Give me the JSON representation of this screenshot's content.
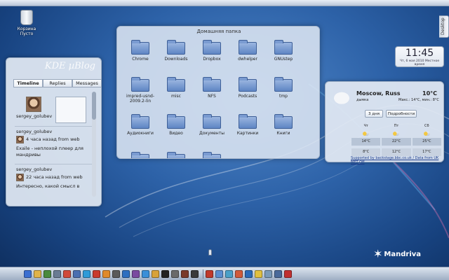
{
  "desktop": {
    "trash_label_line1": "Корзина",
    "trash_label_line2": "Пусто",
    "desktop_tab_label": "Desktop",
    "brand_name": "Mandriva"
  },
  "microblog": {
    "logo": "KDE µBlog",
    "tabs": [
      "Timeline",
      "Replies",
      "Messages"
    ],
    "own_user": "sergey_golubev",
    "posts": [
      {
        "user": "sergey_golubev",
        "meta": "4 часа назад from web",
        "text_line1": "Exaile - неплохой плеер для",
        "text_line2": "мандривы"
      },
      {
        "user": "sergey_golubev",
        "meta": "22 часа назад from web",
        "text_line1": "Интересно, какой смысл в",
        "text_line2": ""
      }
    ]
  },
  "folderview": {
    "title": "Домашняя папка",
    "items": [
      "Chrome",
      "Downloads",
      "Dropbox",
      "dwhelper",
      "GNUstep",
      "impred-usnd-2009.2-lin",
      "misc",
      "NFS",
      "Podcasts",
      "tmp",
      "Аудиокниги",
      "Видео",
      "Документы",
      "Картинки",
      "Книги"
    ]
  },
  "clock": {
    "time": "11:45",
    "date": "Чт, 6 мая 2010 Местное время"
  },
  "weather": {
    "city": "Moscow, Russ",
    "temperature": "10°C",
    "condition": "дымка",
    "range": "Макс.: 14°C, мин.: 8°C",
    "buttons": [
      "3 дня",
      "Подробности"
    ],
    "days": [
      "Чт",
      "Пт",
      "Сб"
    ],
    "highs": [
      "14°C",
      "22°C",
      "25°C"
    ],
    "lows": [
      "8°C",
      "12°C",
      "17°C"
    ],
    "credit": "Supported by backstage.bbc.co.uk / Data from UK MET Off"
  },
  "taskbar": {
    "icon_colors": [
      "#3b6fd1",
      "#e0b34a",
      "#4a8a3e",
      "#6a7b93",
      "#d04a3a",
      "#4a6fb1",
      "#2f9bd8",
      "#c93b2e",
      "#e08a2a",
      "#5a5a5a",
      "#2f6fc0",
      "#7a4aa0",
      "#3a8fd8",
      "#d8a23a",
      "#222222",
      "#6a6a6a",
      "#7a3a2a",
      "#3a3a3a",
      "#c0392b",
      "#5a8ed0",
      "#4aa0c8",
      "#d05a3a",
      "#2a6ab8",
      "#e0c040",
      "#7a9ab8",
      "#4a6a9a",
      "#c03030"
    ]
  }
}
